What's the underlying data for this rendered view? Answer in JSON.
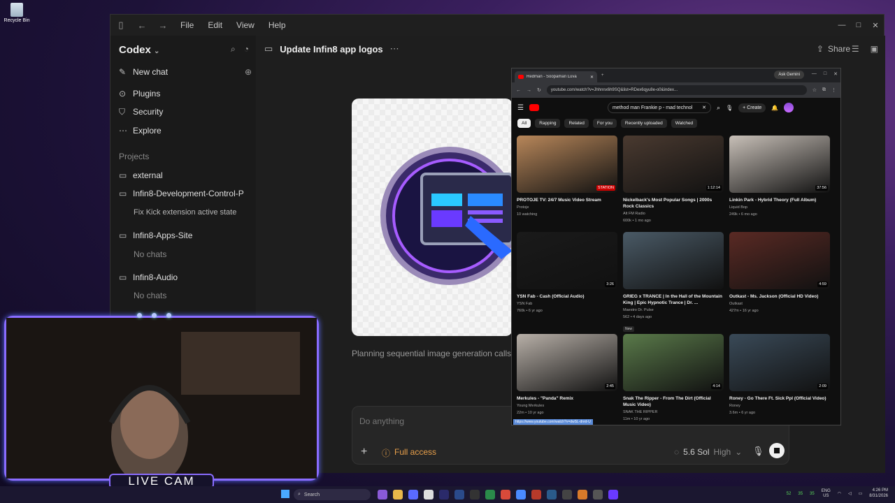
{
  "desktop": {
    "recycle_bin": "Recycle Bin"
  },
  "codex_window": {
    "menu": [
      "File",
      "Edit",
      "View",
      "Help"
    ],
    "brand": "Codex",
    "sidebar": {
      "new_chat": "New chat",
      "items": [
        "Plugins",
        "Security",
        "Explore"
      ],
      "projects_label": "Projects",
      "projects": [
        {
          "name": "external"
        },
        {
          "name": "Infin8-Development-Control-P",
          "child": "Fix Kick extension active state"
        },
        {
          "name": "Infin8-Apps-Site",
          "child": "No chats"
        },
        {
          "name": "Infin8-Audio",
          "child": "No chats"
        }
      ]
    },
    "thread_title": "Update Infin8 app logos",
    "share": "Share",
    "status": "Planning sequential image generation calls",
    "composer": {
      "placeholder": "Do anything",
      "access": "Full access",
      "model": "5.6 Sol",
      "effort": "High"
    }
  },
  "chrome": {
    "tab_title": "Redman - Soopaman Luva",
    "ask_gemini": "Ask Gemini",
    "url": "youtube.com/watch?v=Jhhnnx6h9SQ&list=RDex6qyu8e-o0&index...",
    "search_query": "method man Frankie p - mad technol",
    "create": "Create",
    "chips": [
      "All",
      "Rapping",
      "Related",
      "For you",
      "Recently uploaded",
      "Watched"
    ],
    "videos": [
      {
        "title": "PROTOJE TV: 24/7 Music Video Stream",
        "channel": "Protoje",
        "meta": "10 watching",
        "badge": "STATION",
        "color": "#b8875a"
      },
      {
        "title": "Nickelback's Most Popular Songs | 2000s Rock Classics",
        "channel": "Alt FM Radio",
        "meta": "600k • 1 mo ago",
        "badge": "1:12:14",
        "color": "#4a3a30"
      },
      {
        "title": "Linkin Park - Hybrid Theory (Full Album)",
        "channel": "Liquid Bop",
        "meta": "249k • 6 mo ago",
        "badge": "37:56",
        "color": "#c8c0b8"
      },
      {
        "title": "YSN Fab - Cash (Official Audio)",
        "channel": "YSN Fab",
        "meta": "760k • 6 yr ago",
        "badge": "3:26",
        "color": "#1a1a1a"
      },
      {
        "title": "GRIEG x TRANCE | In the Hall of the Mountain King | Epic Hypnotic Trance | Dr. ...",
        "channel": "Maestro Dr. Pulse",
        "meta": "562 • 4 days ago",
        "badge": "",
        "new": "New",
        "color": "#4a5a66"
      },
      {
        "title": "Outkast - Ms. Jackson (Official HD Video)",
        "channel": "Outkast",
        "meta": "427m • 16 yr ago",
        "badge": "4:59",
        "color": "#5a2a24"
      },
      {
        "title": "Merkules - \"Panda\" Remix",
        "channel": "Young Merkules",
        "meta": "22m • 10 yr ago",
        "badge": "2:45",
        "color": "#b8b0a8"
      },
      {
        "title": "Snak The Ripper - From The Dirt (Official Music Video)",
        "channel": "SNAK THE RIPPER",
        "meta": "11m • 10 yr ago",
        "badge": "4:14",
        "color": "#5a7a4a"
      },
      {
        "title": "Roney - Go There Ft. Sick Ppl (Official Video)",
        "channel": "Roney",
        "meta": "3.6m • 6 yr ago",
        "badge": "2:09",
        "color": "#3a4a58"
      }
    ],
    "hover_url": "https://www.youtube.com/watch?v=dwSL-dnrd-U"
  },
  "webcam": {
    "label": "LIVE CAM"
  },
  "taskbar": {
    "search": "Search",
    "lang": "ENG",
    "region": "US",
    "time": "4:26 PM",
    "date": "8/31/2026",
    "tray_nums": [
      "52",
      "35",
      "35"
    ]
  },
  "colors": {
    "accent": "#8a6cff",
    "yt_red": "#ff0000",
    "access_orange": "#e9a04a"
  }
}
